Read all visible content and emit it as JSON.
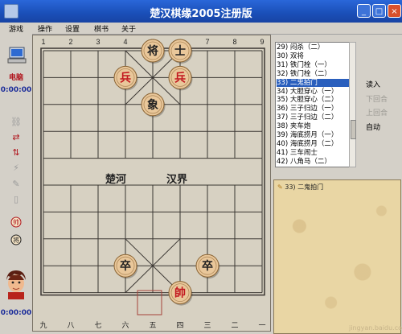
{
  "window": {
    "title": "楚汉棋缘2005注册版",
    "minimize": "_",
    "maximize": "□",
    "close": "×"
  },
  "menu": [
    "游戏",
    "操作",
    "设置",
    "棋书",
    "关于"
  ],
  "players": {
    "top_label": "电脑",
    "top_time": "0:00:00",
    "bottom_time": "0:00:00"
  },
  "board": {
    "top_cols": [
      "1",
      "2",
      "3",
      "4",
      "5",
      "6",
      "7",
      "8",
      "9"
    ],
    "bottom_cols": [
      "九",
      "八",
      "七",
      "六",
      "五",
      "四",
      "三",
      "二",
      "一"
    ],
    "river_left": "楚河",
    "river_right": "汉界",
    "pieces": [
      {
        "text": "将",
        "side": "black",
        "file": 4,
        "rank": 0
      },
      {
        "text": "士",
        "side": "black",
        "file": 5,
        "rank": 0
      },
      {
        "text": "兵",
        "side": "red",
        "file": 3,
        "rank": 1
      },
      {
        "text": "兵",
        "side": "red",
        "file": 5,
        "rank": 1
      },
      {
        "text": "象",
        "side": "black",
        "file": 4,
        "rank": 2
      },
      {
        "text": "卒",
        "side": "black",
        "file": 3,
        "rank": 8
      },
      {
        "text": "卒",
        "side": "black",
        "file": 6,
        "rank": 8
      },
      {
        "text": "帥",
        "side": "red",
        "file": 5,
        "rank": 9
      }
    ]
  },
  "move_list": [
    "29) 闷杀（二）",
    "30) 双将",
    "31) 铁门栓（一）",
    "32) 铁门栓（二）",
    "33) 二鬼拍门",
    "34) 大胆穿心（一）",
    "35) 大胆穿心（二）",
    "36) 三子归边（一）",
    "37) 三子归边（二）",
    "38) 夹车炮",
    "39) 海底捞月（一）",
    "40) 海底捞月（二）",
    "41) 三车闹士",
    "42) 八角马（二）"
  ],
  "selected_index": 4,
  "buttons": {
    "read": "读入",
    "next": "下回合",
    "prev": "上回合",
    "auto": "自动"
  },
  "comment": "33) 二鬼拍门",
  "watermark": "jingyan.baidu.com",
  "colors": {
    "titlebar": "#1a4fb8",
    "red_piece": "#c2181f",
    "black_piece": "#222222",
    "piece_face": "#e9c79a"
  }
}
